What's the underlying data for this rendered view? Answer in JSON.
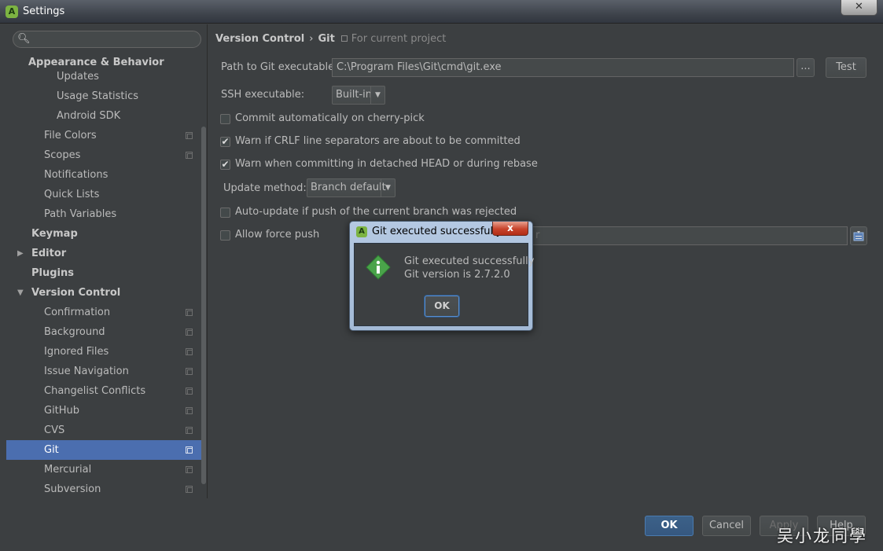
{
  "window": {
    "title": "Settings",
    "close_label": "✕"
  },
  "search": {
    "placeholder": ""
  },
  "sidebar": {
    "items": [
      {
        "label": "Appearance & Behavior",
        "top": 0,
        "indent": 28,
        "bold": true
      },
      {
        "label": "Updates",
        "indent": 64
      },
      {
        "label": "Usage Statistics",
        "indent": 64
      },
      {
        "label": "Android SDK",
        "indent": 64
      },
      {
        "label": "File Colors",
        "indent": 48,
        "project": true
      },
      {
        "label": "Scopes",
        "indent": 48,
        "project": true
      },
      {
        "label": "Notifications",
        "indent": 48
      },
      {
        "label": "Quick Lists",
        "indent": 48
      },
      {
        "label": "Path Variables",
        "indent": 48
      },
      {
        "label": "Keymap",
        "indent": 32,
        "bold": true
      },
      {
        "label": "Editor",
        "indent": 32,
        "bold": true,
        "arrow": "▶"
      },
      {
        "label": "Plugins",
        "indent": 32,
        "bold": true
      },
      {
        "label": "Version Control",
        "indent": 32,
        "bold": true,
        "arrow": "▼"
      },
      {
        "label": "Confirmation",
        "indent": 48,
        "project": true
      },
      {
        "label": "Background",
        "indent": 48,
        "project": true
      },
      {
        "label": "Ignored Files",
        "indent": 48,
        "project": true
      },
      {
        "label": "Issue Navigation",
        "indent": 48,
        "project": true
      },
      {
        "label": "Changelist Conflicts",
        "indent": 48,
        "project": true
      },
      {
        "label": "GitHub",
        "indent": 48,
        "project": true
      },
      {
        "label": "CVS",
        "indent": 48,
        "project": true
      },
      {
        "label": "Git",
        "indent": 48,
        "project": true,
        "selected": true
      },
      {
        "label": "Mercurial",
        "indent": 48,
        "project": true
      },
      {
        "label": "Subversion",
        "indent": 48,
        "project": true
      }
    ]
  },
  "breadcrumb": {
    "part1": "Version Control",
    "separator": "›",
    "part2": "Git",
    "scope": "For current project"
  },
  "git": {
    "path_label": "Path to Git executable:",
    "path_value": "C:\\Program Files\\Git\\cmd\\git.exe",
    "browse_label": "...",
    "test_label": "Test",
    "ssh_label": "SSH executable:",
    "ssh_value": "Built-in",
    "cherry_pick_label": "Commit automatically on cherry-pick",
    "cherry_pick_checked": false,
    "crlf_label": "Warn if CRLF line separators are about to be committed",
    "crlf_checked": true,
    "detached_label": "Warn when committing in detached HEAD or during rebase",
    "detached_checked": true,
    "update_method_label": "Update method:",
    "update_method_value": "Branch default",
    "auto_update_label": "Auto-update if push of the current branch was rejected",
    "auto_update_checked": false,
    "force_push_label": "Allow force push",
    "force_push_checked": false,
    "protected_partial": "r"
  },
  "footer": {
    "ok_label": "OK",
    "cancel_label": "Cancel",
    "apply_label": "Apply",
    "help_label": "Help",
    "watermark": "吴小龙同學"
  },
  "dialog": {
    "title": "Git executed successfully",
    "close_label": "x",
    "message_line1": "Git executed successfully",
    "message_line2": "Git version is 2.7.2.0",
    "ok_label": "OK"
  },
  "colors": {
    "background": "#3c3f41",
    "selection": "#4b6eaf",
    "primary_button": "#365880"
  }
}
